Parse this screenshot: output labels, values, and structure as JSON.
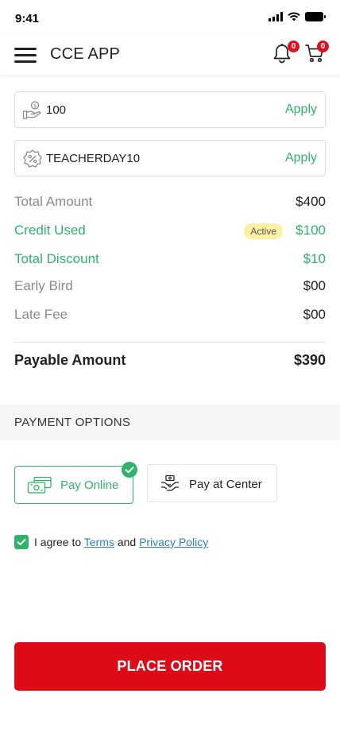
{
  "status_bar": {
    "time": "9:41"
  },
  "header": {
    "title": "CCE APP",
    "notification_count": "0",
    "cart_count": "0"
  },
  "credit_input": {
    "value": "100",
    "apply_label": "Apply",
    "icon": "money-hand-icon"
  },
  "coupon_input": {
    "value": "TEACHERDAY10",
    "apply_label": "Apply",
    "icon": "discount-tag-icon"
  },
  "summary": {
    "total_amount": {
      "label": "Total Amount",
      "value": "$400"
    },
    "credit_used": {
      "label": "Credit Used",
      "value": "$100",
      "badge": "Active"
    },
    "total_discount": {
      "label": "Total Discount",
      "value": "$10"
    },
    "early_bird": {
      "label": "Early Bird",
      "value": "$00"
    },
    "late_fee": {
      "label": "Late Fee",
      "value": "$00"
    },
    "payable_amount": {
      "label": "Payable Amount",
      "value": "$390"
    }
  },
  "payment": {
    "section_title": "PAYMENT OPTIONS",
    "options": [
      {
        "label": "Pay Online",
        "selected": true,
        "icon": "card-cash-icon"
      },
      {
        "label": "Pay at Center",
        "selected": false,
        "icon": "cash-handover-icon"
      }
    ]
  },
  "agreement": {
    "prefix": "I agree to",
    "terms": "Terms",
    "and": "and",
    "privacy": "Privacy Policy",
    "checked": true
  },
  "place_order_label": "PLACE ORDER",
  "colors": {
    "accent_green": "#2fb36a",
    "primary_red": "#dd0a17",
    "badge_yellow": "#fbf0a3",
    "link_blue": "#2b7fc0"
  }
}
